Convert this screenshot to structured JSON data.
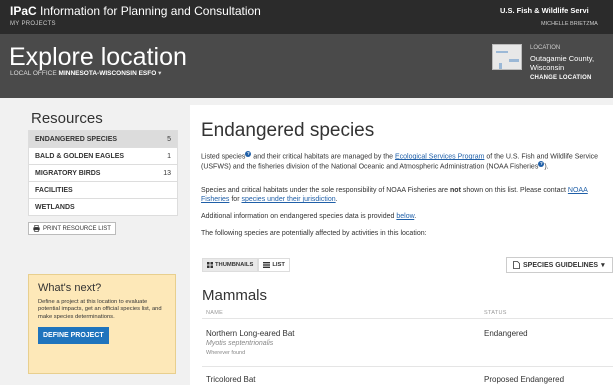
{
  "header": {
    "brand_short": "IPaC",
    "brand_full": "Information for Planning and Consultation",
    "my_projects": "MY PROJECTS",
    "agency": "U.S. Fish & Wildlife Servi",
    "user": "MICHELLE BRIETZMA"
  },
  "hero": {
    "title": "Explore location",
    "office_label": "LOCAL OFFICE",
    "office_name": "MINNESOTA-WISCONSIN ESFO",
    "office_caret": "▾",
    "location_label": "LOCATION",
    "location_line1": "Outagamie County,",
    "location_line2": "Wisconsin",
    "change_location": "CHANGE LOCATION"
  },
  "sidebar": {
    "title": "Resources",
    "items": [
      {
        "label": "ENDANGERED SPECIES",
        "count": "5"
      },
      {
        "label": "BALD & GOLDEN EAGLES",
        "count": "1"
      },
      {
        "label": "MIGRATORY BIRDS",
        "count": "13"
      },
      {
        "label": "FACILITIES",
        "count": ""
      },
      {
        "label": "WETLANDS",
        "count": ""
      }
    ],
    "print_label": "PRINT RESOURCE LIST"
  },
  "whatsnext": {
    "title": "What's next?",
    "text": "Define a project at this location to evaluate potential impacts, get an official species list, and make species determinations.",
    "button": "DEFINE PROJECT"
  },
  "main": {
    "title": "Endangered species",
    "p1": {
      "a": "Listed species",
      "b": " and their critical habitats are managed by the ",
      "link": "Ecological Services Program",
      "c": " of the U.S. Fish and Wildlife Service (USFWS) and the fisheries division of the National Oceanic and Atmospheric Administration (NOAA Fisheries",
      "d": ")."
    },
    "p2": {
      "a": "Species and critical habitats under the sole responsibility of NOAA Fisheries are ",
      "bold": "not",
      "b": " shown on this list. Please contact ",
      "link1": "NOAA Fisheries",
      "c": " for ",
      "link2": "species under their jurisdiction",
      "d": "."
    },
    "p3": {
      "a": "Additional information on endangered species data is provided ",
      "link": "below",
      "b": "."
    },
    "p4": "The following species are potentially affected by activities in this location:",
    "view_thumbnails": "THUMBNAILS",
    "view_list": "LIST",
    "guidelines": "SPECIES GUIDELINES",
    "guidelines_caret": "▾",
    "group_title": "Mammals",
    "col_name": "NAME",
    "col_status": "STATUS",
    "species": [
      {
        "name": "Northern Long-eared Bat",
        "sci": "Myotis septentrionalis",
        "where": "Wherever found",
        "status": "Endangered"
      },
      {
        "name": "Tricolored Bat",
        "sci": "",
        "where": "",
        "status": "Proposed Endangered"
      }
    ]
  }
}
